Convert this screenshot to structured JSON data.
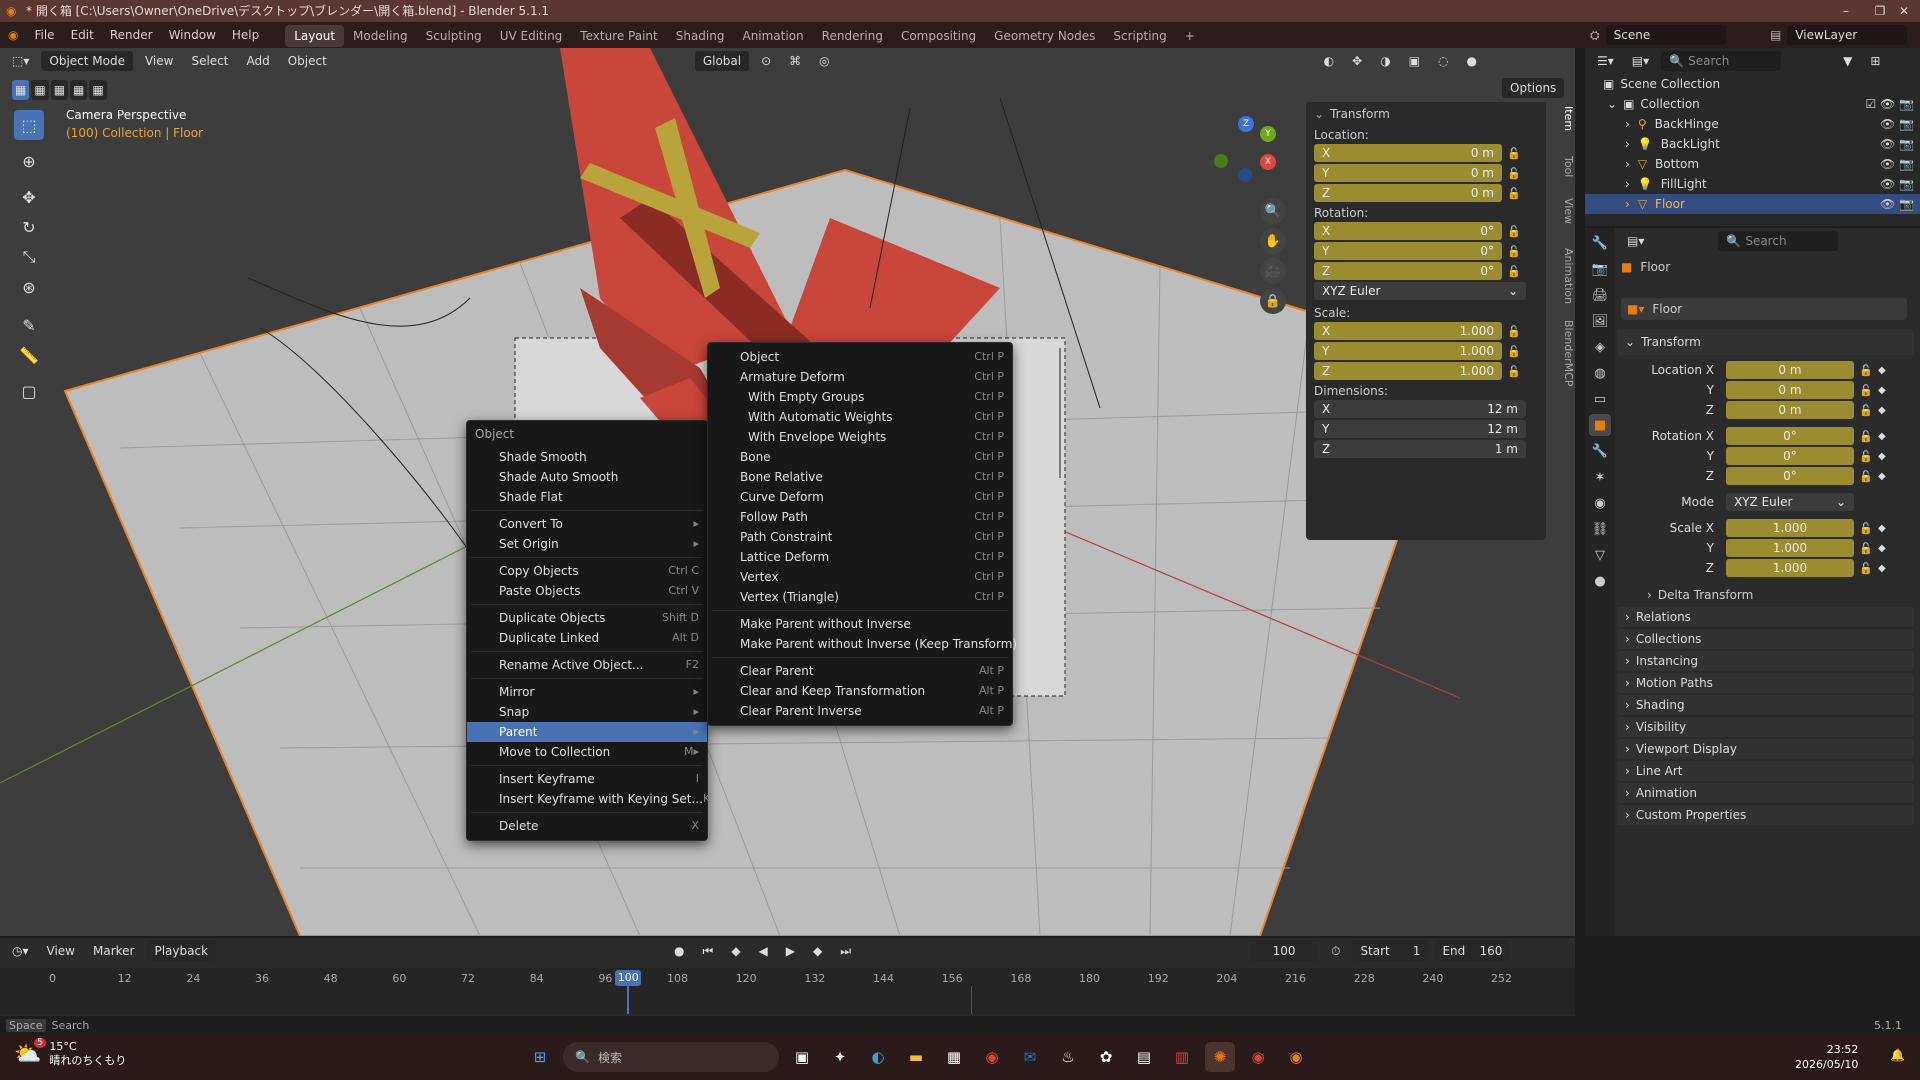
{
  "titlebar": {
    "title": "* 開く箱 [C:\\Users\\Owner\\OneDrive\\デスクトップ\\ブレンダー\\開く箱.blend] - Blender 5.1.1",
    "minimize": "–",
    "maximize": "❐",
    "close": "✕"
  },
  "menubar": {
    "items": [
      "File",
      "Edit",
      "Render",
      "Window",
      "Help"
    ],
    "workspaces": [
      "Layout",
      "Modeling",
      "Sculpting",
      "UV Editing",
      "Texture Paint",
      "Shading",
      "Animation",
      "Rendering",
      "Compositing",
      "Geometry Nodes",
      "Scripting"
    ],
    "active_workspace": "Layout",
    "add": "+",
    "scene": "Scene",
    "viewlayer": "ViewLayer"
  },
  "viewport": {
    "mode": "Object Mode",
    "menus": [
      "View",
      "Select",
      "Add",
      "Object"
    ],
    "orientation": "Global",
    "options": "Options",
    "camera_label": "Camera Perspective",
    "collection_label": "(100) Collection | Floor"
  },
  "context_menu": {
    "title": "Object",
    "items": [
      {
        "label": "Shade Smooth",
        "shortcut": ""
      },
      {
        "label": "Shade Auto Smooth",
        "shortcut": ""
      },
      {
        "label": "Shade Flat",
        "shortcut": ""
      },
      {
        "sep": true
      },
      {
        "label": "Convert To",
        "shortcut": "▸"
      },
      {
        "label": "Set Origin",
        "shortcut": "▸"
      },
      {
        "sep": true
      },
      {
        "label": "Copy Objects",
        "shortcut": "Ctrl C"
      },
      {
        "label": "Paste Objects",
        "shortcut": "Ctrl V"
      },
      {
        "sep": true
      },
      {
        "label": "Duplicate Objects",
        "shortcut": "Shift D"
      },
      {
        "label": "Duplicate Linked",
        "shortcut": "Alt D"
      },
      {
        "sep": true
      },
      {
        "label": "Rename Active Object...",
        "shortcut": "F2"
      },
      {
        "sep": true
      },
      {
        "label": "Mirror",
        "shortcut": "▸"
      },
      {
        "label": "Snap",
        "shortcut": "▸"
      },
      {
        "label": "Parent",
        "shortcut": "▸",
        "active": true
      },
      {
        "label": "Move to Collection",
        "shortcut": "M▸"
      },
      {
        "sep": true
      },
      {
        "label": "Insert Keyframe",
        "shortcut": "I"
      },
      {
        "label": "Insert Keyframe with Keying Set...",
        "shortcut": "K"
      },
      {
        "sep": true
      },
      {
        "label": "Delete",
        "shortcut": "X"
      }
    ]
  },
  "parent_menu": {
    "items": [
      {
        "label": "Object",
        "shortcut": "Ctrl P"
      },
      {
        "label": "Armature Deform",
        "shortcut": "Ctrl P"
      },
      {
        "label": "With Empty Groups",
        "shortcut": "Ctrl P",
        "indent": true
      },
      {
        "label": "With Automatic Weights",
        "shortcut": "Ctrl P",
        "indent": true
      },
      {
        "label": "With Envelope Weights",
        "shortcut": "Ctrl P",
        "indent": true
      },
      {
        "label": "Bone",
        "shortcut": "Ctrl P"
      },
      {
        "label": "Bone Relative",
        "shortcut": "Ctrl P"
      },
      {
        "label": "Curve Deform",
        "shortcut": "Ctrl P"
      },
      {
        "label": "Follow Path",
        "shortcut": "Ctrl P"
      },
      {
        "label": "Path Constraint",
        "shortcut": "Ctrl P"
      },
      {
        "label": "Lattice Deform",
        "shortcut": "Ctrl P"
      },
      {
        "label": "Vertex",
        "shortcut": "Ctrl P"
      },
      {
        "label": "Vertex (Triangle)",
        "shortcut": "Ctrl P"
      },
      {
        "sep": true
      },
      {
        "label": "Make Parent without Inverse",
        "shortcut": ""
      },
      {
        "label": "Make Parent without Inverse (Keep Transform)",
        "shortcut": ""
      },
      {
        "sep": true
      },
      {
        "label": "Clear Parent",
        "shortcut": "Alt P"
      },
      {
        "label": "Clear and Keep Transformation",
        "shortcut": "Alt P"
      },
      {
        "label": "Clear Parent Inverse",
        "shortcut": "Alt P"
      }
    ]
  },
  "npanel": {
    "title": "Transform",
    "location_label": "Location:",
    "location": [
      {
        "axis": "X",
        "value": "0 m"
      },
      {
        "axis": "Y",
        "value": "0 m"
      },
      {
        "axis": "Z",
        "value": "0 m"
      }
    ],
    "rotation_label": "Rotation:",
    "rotation": [
      {
        "axis": "X",
        "value": "0°"
      },
      {
        "axis": "Y",
        "value": "0°"
      },
      {
        "axis": "Z",
        "value": "0°"
      }
    ],
    "rotation_mode": "XYZ Euler",
    "scale_label": "Scale:",
    "scale": [
      {
        "axis": "X",
        "value": "1.000"
      },
      {
        "axis": "Y",
        "value": "1.000"
      },
      {
        "axis": "Z",
        "value": "1.000"
      }
    ],
    "dimensions_label": "Dimensions:",
    "dimensions": [
      {
        "axis": "X",
        "value": "12 m"
      },
      {
        "axis": "Y",
        "value": "12 m"
      },
      {
        "axis": "Z",
        "value": "1 m"
      }
    ],
    "tabs": [
      "Item",
      "Tool",
      "View",
      "Animation",
      "BlenderMCP"
    ]
  },
  "outliner": {
    "search_placeholder": "Search",
    "root": "Scene Collection",
    "collection": "Collection",
    "items": [
      {
        "name": "BackHinge",
        "selected": false
      },
      {
        "name": "BackLight",
        "selected": false
      },
      {
        "name": "Bottom",
        "selected": false
      },
      {
        "name": "FillLight",
        "selected": false
      },
      {
        "name": "Floor",
        "selected": true
      }
    ]
  },
  "properties": {
    "search_placeholder": "Search",
    "object_name": "Floor",
    "data_name": "Floor",
    "transform_title": "Transform",
    "location": [
      {
        "label": "Location X",
        "value": "0 m"
      },
      {
        "label": "Y",
        "value": "0 m"
      },
      {
        "label": "Z",
        "value": "0 m"
      }
    ],
    "rotation": [
      {
        "label": "Rotation X",
        "value": "0°"
      },
      {
        "label": "Y",
        "value": "0°"
      },
      {
        "label": "Z",
        "value": "0°"
      }
    ],
    "mode_label": "Mode",
    "mode_value": "XYZ Euler",
    "scale": [
      {
        "label": "Scale X",
        "value": "1.000"
      },
      {
        "label": "Y",
        "value": "1.000"
      },
      {
        "label": "Z",
        "value": "1.000"
      }
    ],
    "delta": "Delta Transform",
    "sections": [
      "Relations",
      "Collections",
      "Instancing",
      "Motion Paths",
      "Shading",
      "Visibility",
      "Viewport Display",
      "Line Art",
      "Animation",
      "Custom Properties"
    ]
  },
  "timeline": {
    "menus": [
      "View",
      "Marker",
      "Playback"
    ],
    "current_frame": "100",
    "start_label": "Start",
    "start": "1",
    "end_label": "End",
    "end": "160",
    "ticks": [
      "0",
      "12",
      "24",
      "36",
      "48",
      "60",
      "72",
      "84",
      "96",
      "108",
      "120",
      "132",
      "144",
      "156",
      "168",
      "180",
      "192",
      "204",
      "216",
      "228",
      "240",
      "252"
    ],
    "playhead": "100"
  },
  "statusbar": {
    "key": "Space",
    "action": "Search",
    "version": "5.1.1"
  },
  "taskbar": {
    "temp": "15°C",
    "weather": "晴れのちくもり",
    "badge": "5",
    "search_placeholder": "検索",
    "time": "23:52",
    "date": "2026/05/10"
  },
  "colors": {
    "accent": "#4772b3",
    "selection": "#e8832a",
    "field_yellow": "#9c8c30",
    "titlebar": "#5a3730",
    "box_red": "#c8463a"
  }
}
